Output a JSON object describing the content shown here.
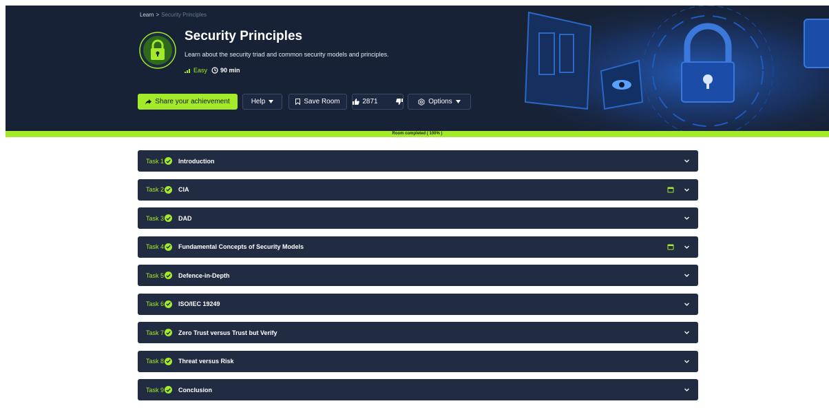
{
  "breadcrumb": {
    "root": "Learn",
    "separator": ">",
    "current": "Security Principles"
  },
  "room": {
    "title": "Security Principles",
    "description": "Learn about the security triad and common security models and principles.",
    "difficulty": "Easy",
    "duration": "90 min"
  },
  "actions": {
    "share": "Share your achievement",
    "help": "Help",
    "save": "Save Room",
    "upvotes": "2871",
    "options": "Options"
  },
  "progress": {
    "label": "Room completed ( 100% )",
    "percent": 100
  },
  "colors": {
    "accent": "#a3ea2a",
    "header_bg": "#172237",
    "task_bg": "#212c42"
  },
  "tasks": [
    {
      "number": "Task 1",
      "title": "Introduction",
      "has_calendar": false
    },
    {
      "number": "Task 2",
      "title": "CIA",
      "has_calendar": true
    },
    {
      "number": "Task 3",
      "title": "DAD",
      "has_calendar": false
    },
    {
      "number": "Task 4",
      "title": "Fundamental Concepts of Security Models",
      "has_calendar": true
    },
    {
      "number": "Task 5",
      "title": "Defence-in-Depth",
      "has_calendar": false
    },
    {
      "number": "Task 6",
      "title": "ISO/IEC 19249",
      "has_calendar": false
    },
    {
      "number": "Task 7",
      "title": "Zero Trust versus Trust but Verify",
      "has_calendar": false
    },
    {
      "number": "Task 8",
      "title": "Threat versus Risk",
      "has_calendar": false
    },
    {
      "number": "Task 9",
      "title": "Conclusion",
      "has_calendar": false
    }
  ]
}
